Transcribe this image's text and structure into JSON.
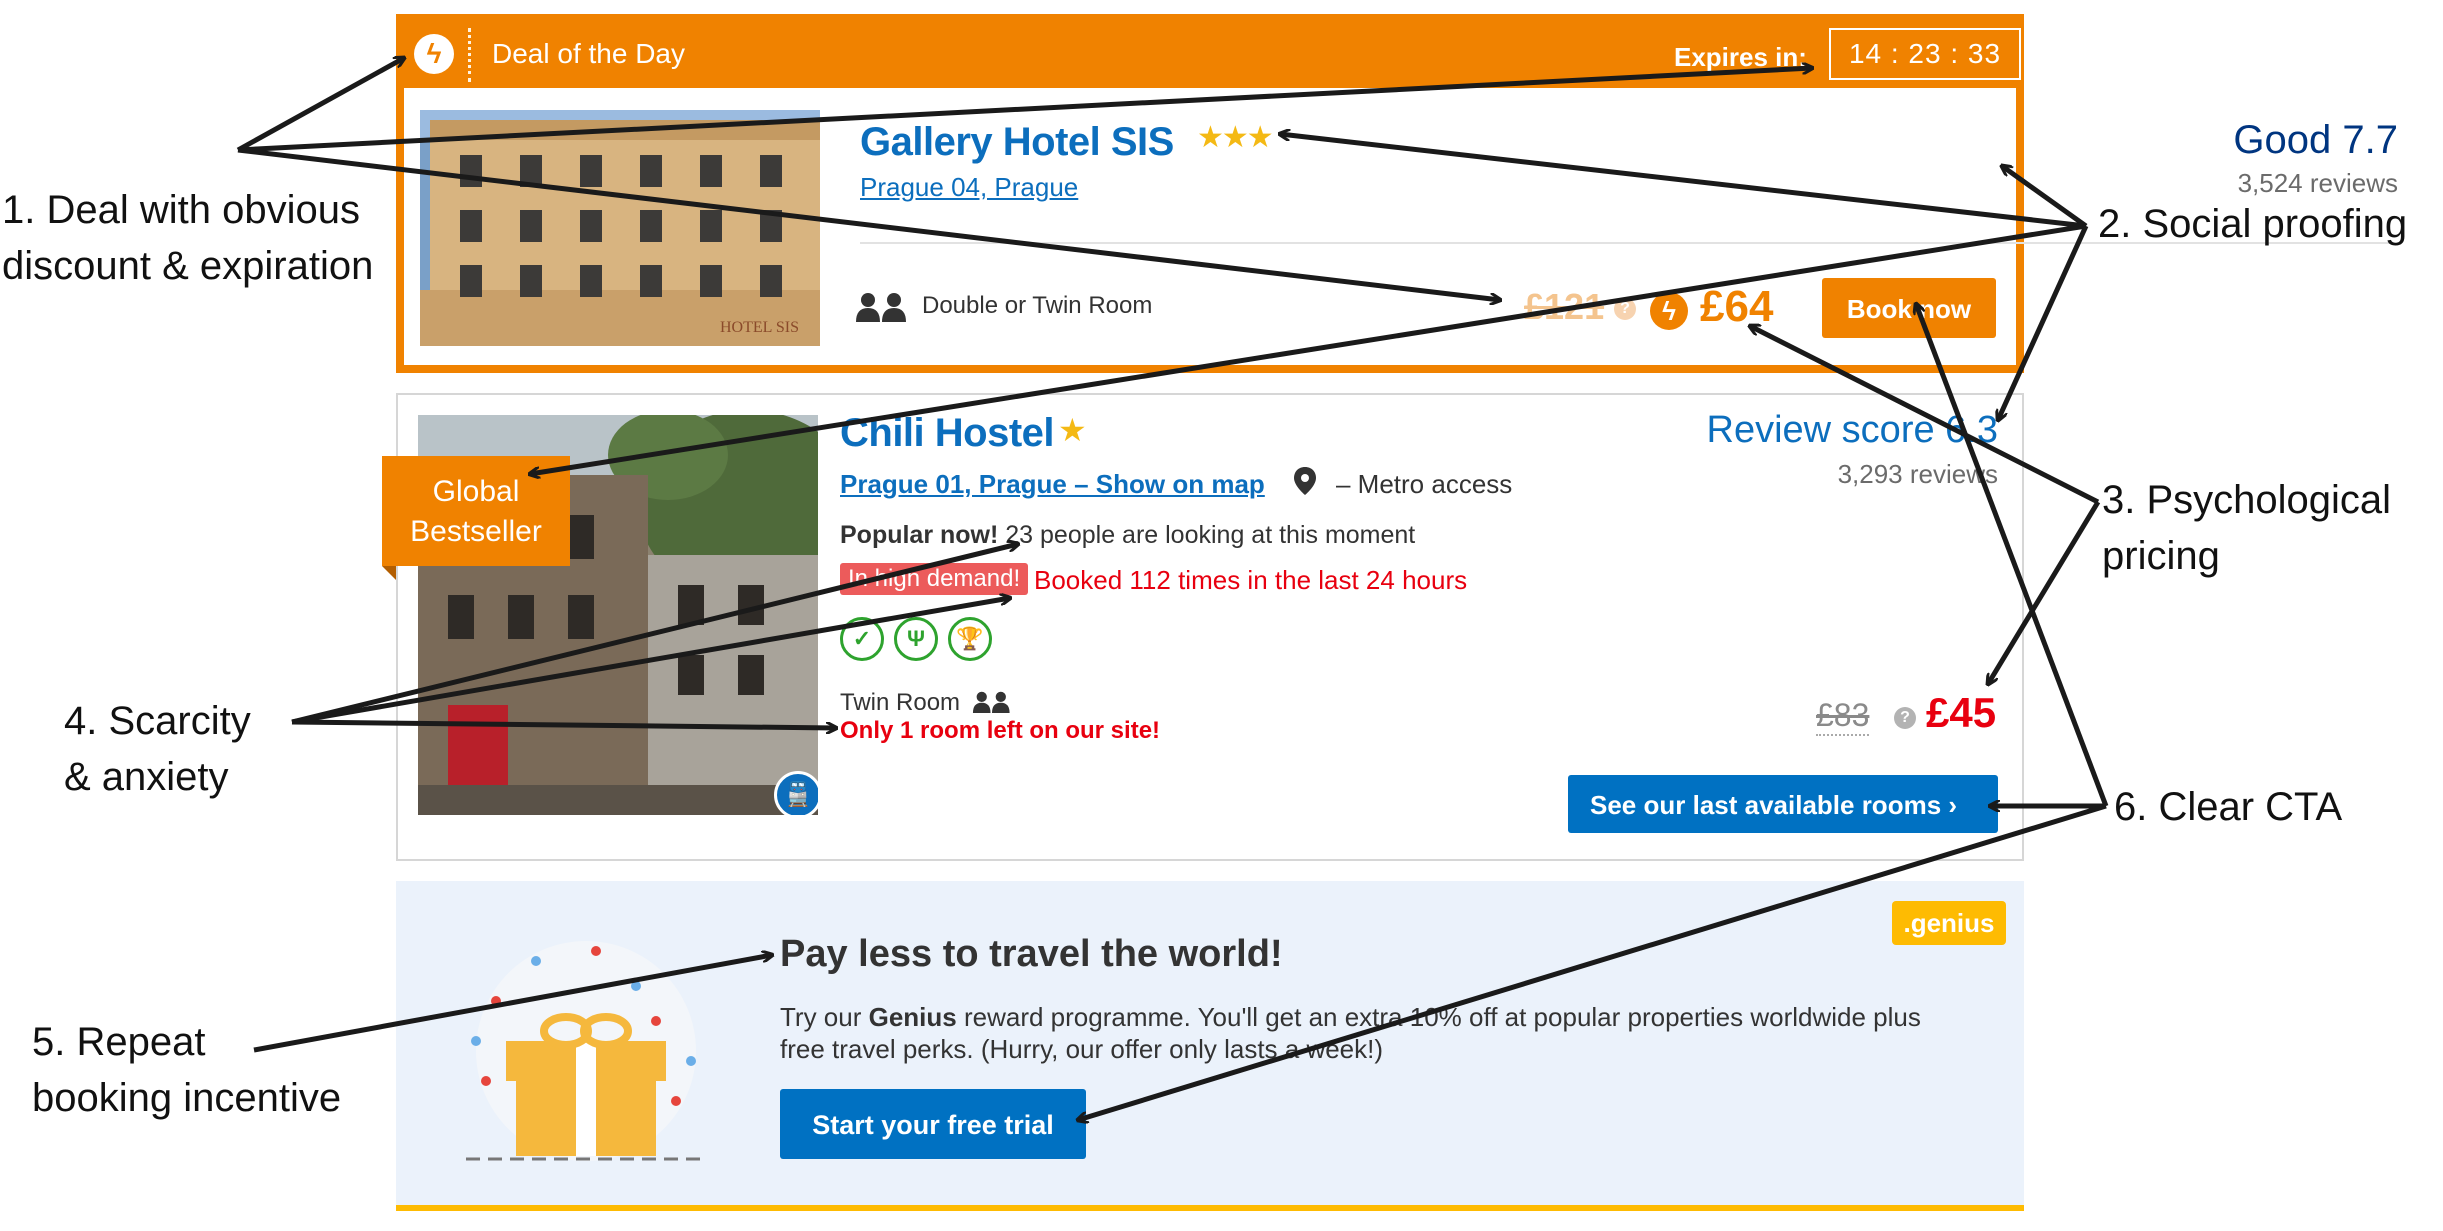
{
  "deal": {
    "title": "Deal of the Day",
    "expires_label": "Expires in:",
    "timer": "14 : 23 : 33",
    "hotel_name": "Gallery Hotel SIS",
    "stars": "★★★",
    "location": "Prague 04, Prague",
    "score": "Good 7.7",
    "reviews": "3,524 reviews",
    "room": "Double or Twin Room",
    "old_price": "£121",
    "new_price": "£64",
    "book_label": "Book now",
    "sign_text": "HOTEL SIS",
    "accent": "#f08200"
  },
  "hostel": {
    "name": "Chili Hostel",
    "star": "★",
    "location": "Prague 01, Prague – Show on map",
    "metro": "– Metro access",
    "score": "Review score 6.3",
    "reviews": "3,293 reviews",
    "popular_bold": "Popular now!",
    "popular_rest": " 23 people are looking at this moment",
    "demand_badge": "In high demand!",
    "booked": "Booked 112 times in the last 24 hours",
    "room": "Twin Room",
    "only_left": "Only 1 room left on our site!",
    "old_price": "£83",
    "new_price": "£45",
    "rooms_button": "See our last available rooms  ›",
    "bestseller_line1": "Global",
    "bestseller_line2": "Bestseller"
  },
  "genius": {
    "badge": ".genius",
    "title": "Pay less to travel the world!",
    "text_pre": "Try our ",
    "text_bold": "Genius",
    "text_post": " reward programme. You'll get an extra 10% off at popular properties worldwide plus free travel perks. (Hurry, our offer only lasts a week!)",
    "button": "Start your free trial"
  },
  "annotations": {
    "a1_line1": "1. Deal with obvious",
    "a1_line2": "discount & expiration",
    "a2": "2. Social proofing",
    "a3_line1": "3. Psychological",
    "a3_line2": "pricing",
    "a4_line1": "4. Scarcity",
    "a4_line2": "& anxiety",
    "a5_line1": "5. Repeat",
    "a5_line2": "booking incentive",
    "a6": "6. Clear CTA"
  },
  "icons": [
    "bolt-icon",
    "star-icon",
    "users-icon",
    "info-icon",
    "pin-icon",
    "train-icon",
    "shield-check-icon",
    "cutlery-icon",
    "trophy-icon",
    "gift-icon"
  ]
}
